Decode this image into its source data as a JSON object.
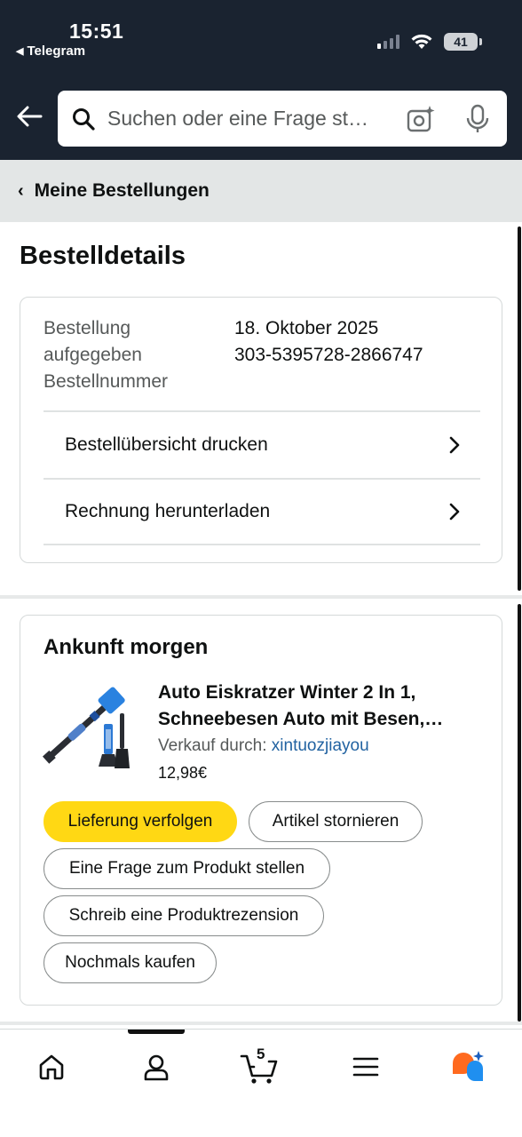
{
  "status_bar": {
    "time": "15:51",
    "back_app": "Telegram",
    "battery": "41"
  },
  "search": {
    "placeholder": "Suchen oder eine Frage st…"
  },
  "breadcrumb": {
    "label": "Meine Bestellungen"
  },
  "page": {
    "title": "Bestelldetails"
  },
  "order_info": {
    "placed_label_line1": "Bestellung",
    "placed_label_line2": "aufgegeben",
    "number_label": "Bestellnummer",
    "date": "18. Oktober 2025",
    "number": "303-5395728-2866747"
  },
  "links": {
    "print_summary": "Bestellübersicht drucken",
    "download_invoice": "Rechnung herunterladen"
  },
  "shipment": {
    "arrival": "Ankunft morgen",
    "product_title": "Auto Eiskratzer Winter 2 In 1, Schneebesen Auto mit Besen,…",
    "sold_by_label": "Verkauf durch: ",
    "seller": "xintuozjiayou",
    "price": "12,98€"
  },
  "actions": {
    "track": "Lieferung verfolgen",
    "cancel": "Artikel stornieren",
    "ask": "Eine Frage zum Produkt stellen",
    "review": "Schreib eine Produktrezension",
    "buy_again": "Nochmals kaufen"
  },
  "bottom_nav": {
    "cart_count": "5",
    "items": [
      "home-icon",
      "account-icon",
      "cart-icon",
      "menu-icon",
      "rufus-ai-icon"
    ]
  },
  "colors": {
    "header_bg": "#1a2330",
    "primary_button": "#ffd814",
    "link": "#2162a1"
  }
}
